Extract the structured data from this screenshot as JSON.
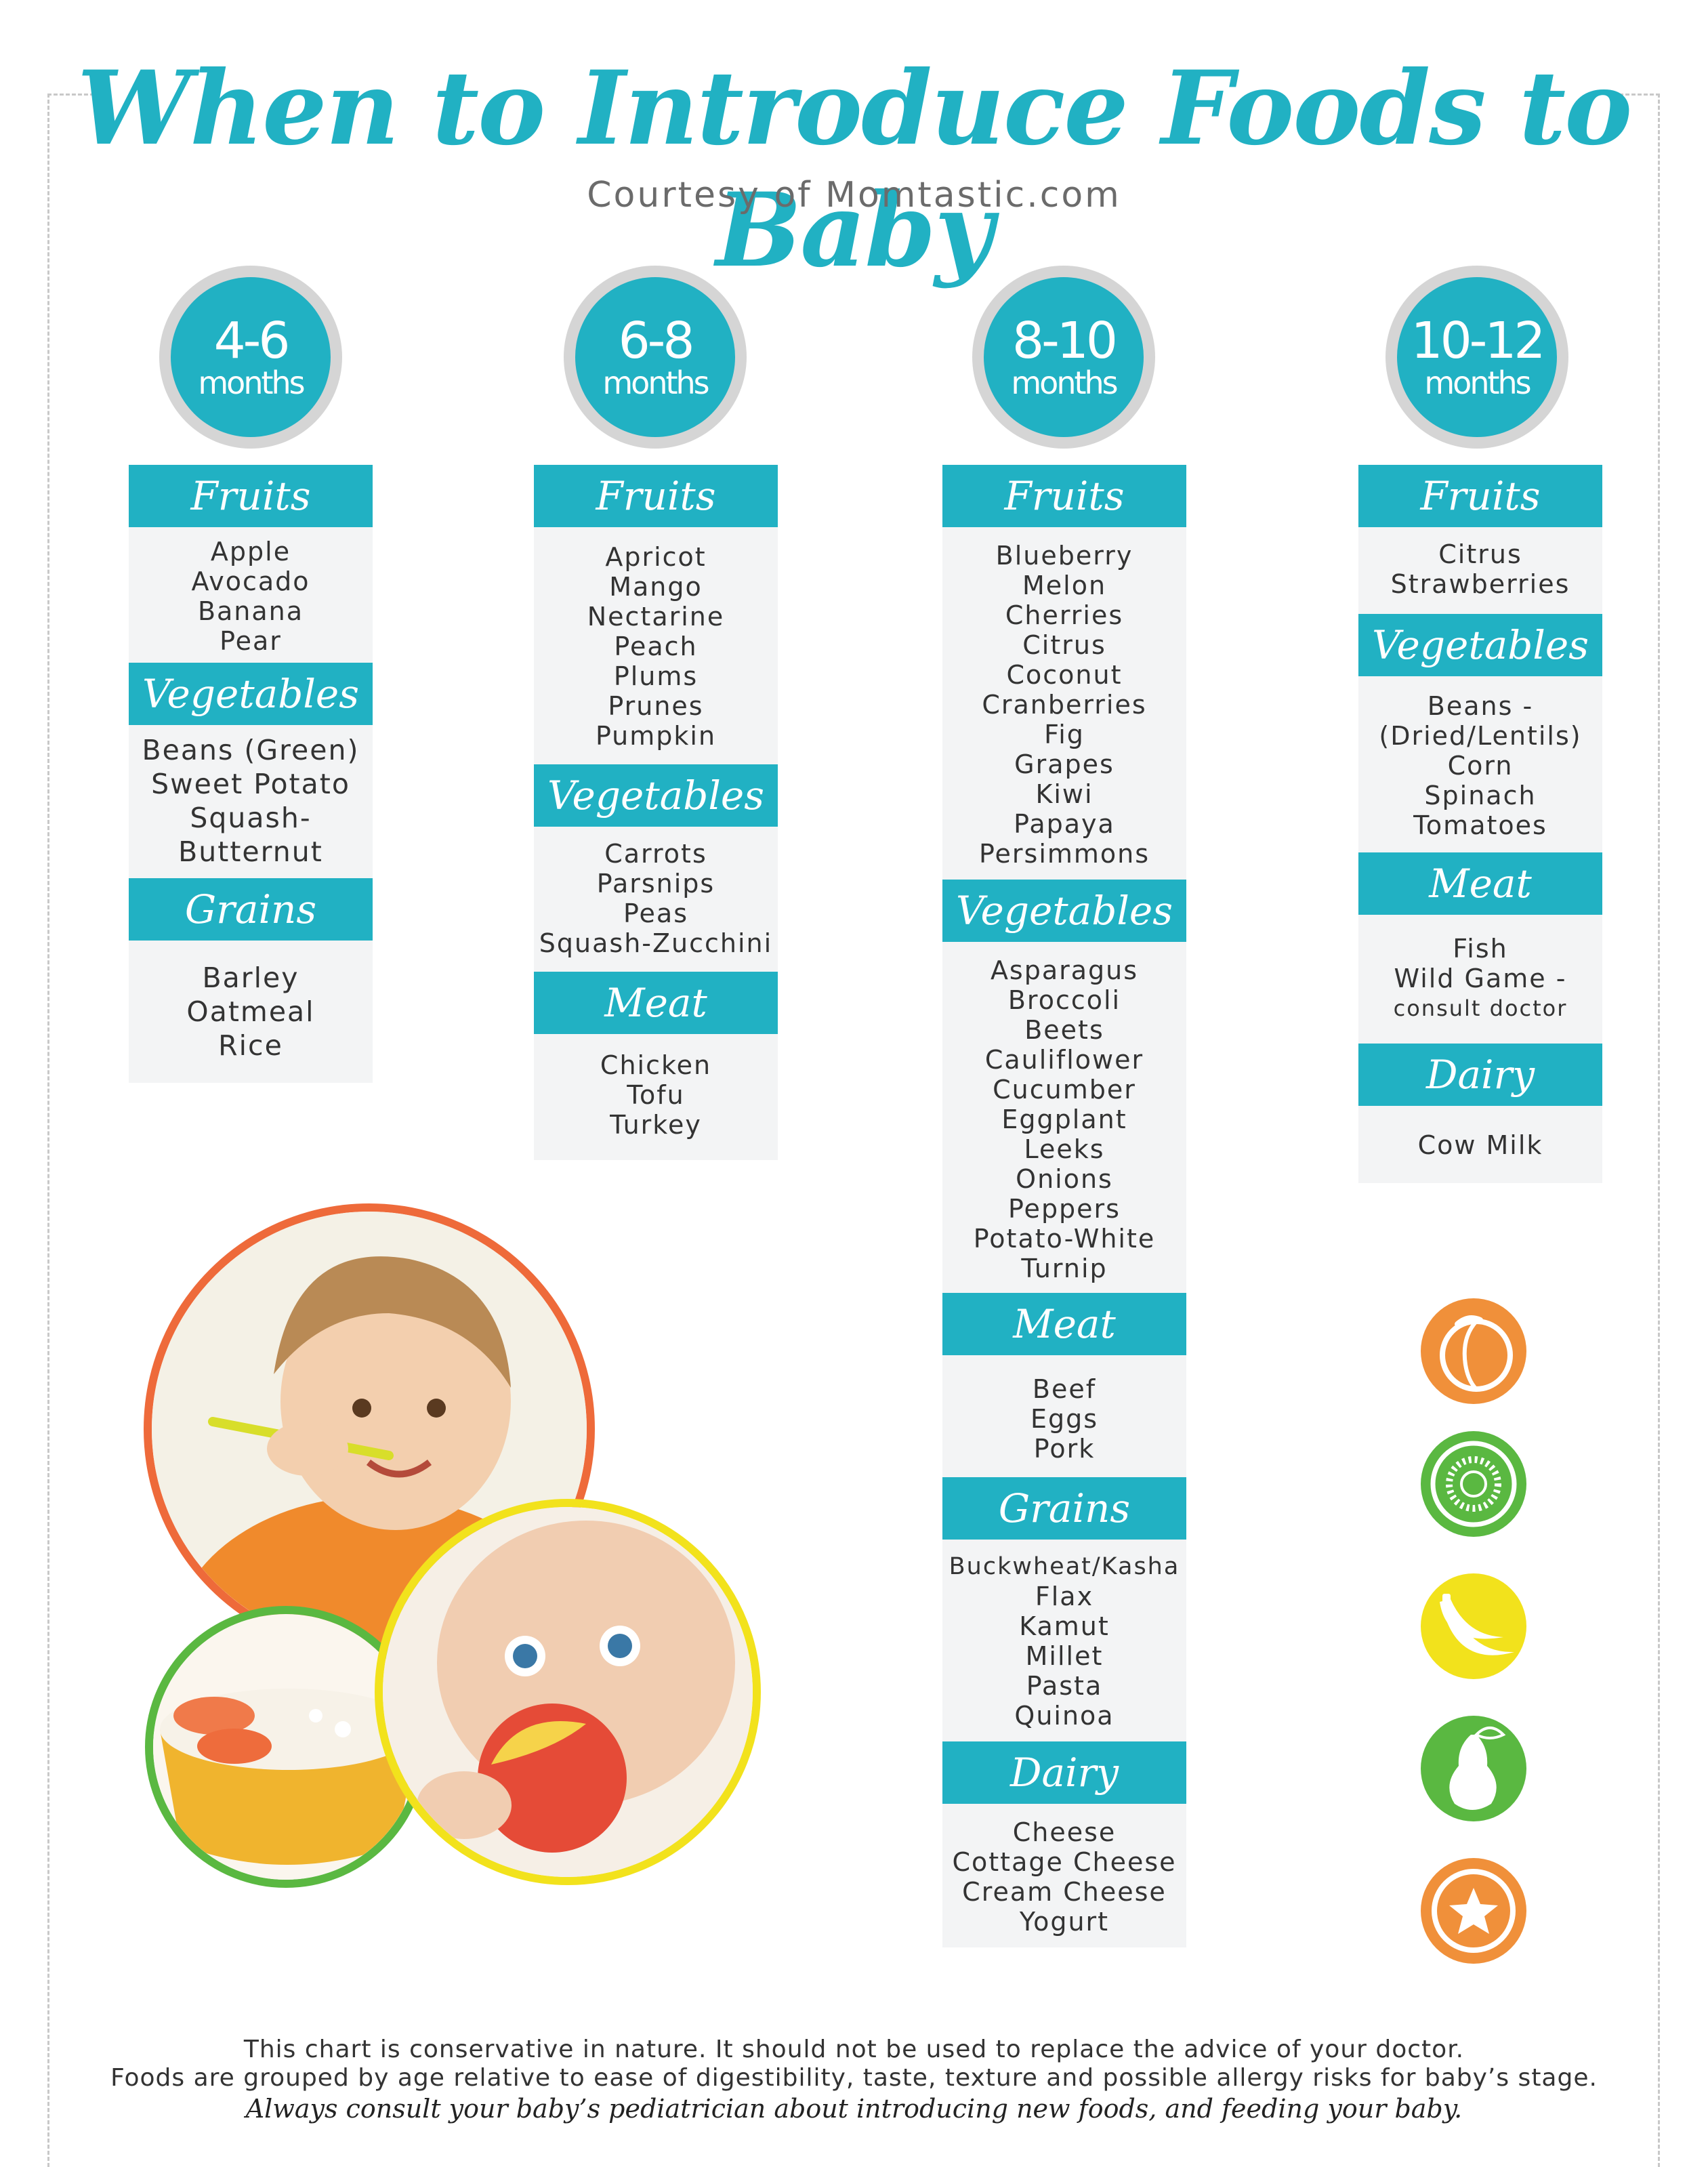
{
  "title": "When to Introduce Foods to Baby",
  "subtitle": "Courtesy of Momtastic.com",
  "columns": [
    {
      "range": "4-6",
      "unit": "months",
      "sections": [
        {
          "heading": "Fruits",
          "items": [
            "Apple",
            "Avocado",
            "Banana",
            "Pear"
          ]
        },
        {
          "heading": "Vegetables",
          "items": [
            "Beans (Green)",
            "Sweet Potato",
            "Squash-",
            "Butternut"
          ]
        },
        {
          "heading": "Grains",
          "items": [
            "Barley",
            "Oatmeal",
            "Rice"
          ]
        }
      ]
    },
    {
      "range": "6-8",
      "unit": "months",
      "sections": [
        {
          "heading": "Fruits",
          "items": [
            "Apricot",
            "Mango",
            "Nectarine",
            "Peach",
            "Plums",
            "Prunes",
            "Pumpkin"
          ]
        },
        {
          "heading": "Vegetables",
          "items": [
            "Carrots",
            "Parsnips",
            "Peas",
            "Squash-Zucchini"
          ]
        },
        {
          "heading": "Meat",
          "items": [
            "Chicken",
            "Tofu",
            "Turkey"
          ]
        }
      ]
    },
    {
      "range": "8-10",
      "unit": "months",
      "sections": [
        {
          "heading": "Fruits",
          "items": [
            "Blueberry",
            "Melon",
            "Cherries",
            "Citrus",
            "Coconut",
            "Cranberries",
            "Fig",
            "Grapes",
            "Kiwi",
            "Papaya",
            "Persimmons"
          ]
        },
        {
          "heading": "Vegetables",
          "items": [
            "Asparagus",
            "Broccoli",
            "Beets",
            "Cauliflower",
            "Cucumber",
            "Eggplant",
            "Leeks",
            "Onions",
            "Peppers",
            "Potato-White",
            "Turnip"
          ]
        },
        {
          "heading": "Meat",
          "items": [
            "Beef",
            "Eggs",
            "Pork"
          ]
        },
        {
          "heading": "Grains",
          "items": [
            "Buckwheat/Kasha",
            "Flax",
            "Kamut",
            "Millet",
            "Pasta",
            "Quinoa"
          ]
        },
        {
          "heading": "Dairy",
          "items": [
            "Cheese",
            "Cottage Cheese",
            "Cream Cheese",
            "Yogurt"
          ]
        }
      ]
    },
    {
      "range": "10-12",
      "unit": "months",
      "sections": [
        {
          "heading": "Fruits",
          "items": [
            "Citrus",
            "Strawberries"
          ]
        },
        {
          "heading": "Vegetables",
          "items": [
            "Beans -",
            "(Dried/Lentils)",
            "Corn",
            "Spinach",
            "Tomatoes"
          ]
        },
        {
          "heading": "Meat",
          "items": [
            "Fish",
            "Wild Game -",
            "consult doctor"
          ]
        },
        {
          "heading": "Dairy",
          "items": [
            "Cow Milk"
          ]
        }
      ]
    }
  ],
  "icons": [
    "peach-icon",
    "kiwi-icon",
    "banana-icon",
    "pear-icon",
    "star-fruit-icon"
  ],
  "colors": {
    "accent": "#21b1c3",
    "panel": "#f3f4f5",
    "orange": "#f0903a",
    "green": "#5ab841",
    "yellow": "#f2e21c"
  },
  "footer": {
    "line1": "This chart is conservative in nature. It should not be used to replace the advice of your doctor.",
    "line2": "Foods are grouped by age relative to ease of digestibility, taste, texture and possible allergy risks for baby’s stage.",
    "line3": "Always consult your baby’s pediatrician about introducing new foods, and feeding your baby."
  }
}
